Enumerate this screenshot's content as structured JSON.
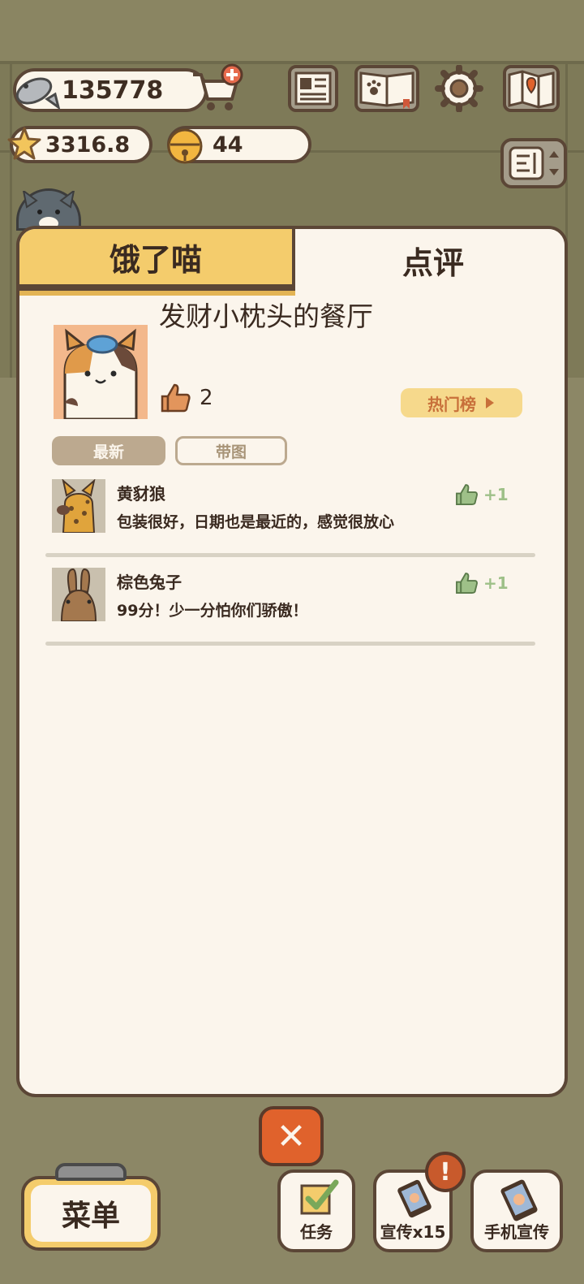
{
  "resources": {
    "fish": "135778",
    "stars": "3316.8",
    "bells": "44"
  },
  "tabs": {
    "left": "饿了喵",
    "right": "点评"
  },
  "restaurant": {
    "name": "发财小枕头的餐厅",
    "likes": "2",
    "hot_list_label": "热门榜"
  },
  "filters": {
    "newest": "最新",
    "with_image": "带图"
  },
  "reviews": [
    {
      "name": "黄豺狼",
      "text": "包装很好，日期也是最近的，感觉很放心",
      "like": "+1"
    },
    {
      "name": "棕色兔子",
      "text": "99分！少一分怕你们骄傲！",
      "like": "+1"
    }
  ],
  "bottom": {
    "close": "✕",
    "menu": "菜单",
    "tasks": "任务",
    "promo": "宣传x15",
    "phone_promo": "手机宣传",
    "badge": "!"
  },
  "colors": {
    "accent_yellow": "#f4cc6c",
    "close_orange": "#e0622c",
    "like_green": "#9ec088",
    "panel_bg": "#fbf5ec"
  },
  "icons": {
    "fish": "fish-icon",
    "cart": "cart-plus-icon",
    "star": "star-icon",
    "bell": "bell-icon",
    "newspaper": "newspaper-icon",
    "paw_book": "paw-book-icon",
    "gear": "gear-icon",
    "map": "map-icon",
    "toggle": "toggle-icon",
    "thumb_up": "thumb-up-icon",
    "play": "play-arrow-icon",
    "checkbox": "checkbox-icon",
    "phone": "phone-icon"
  }
}
